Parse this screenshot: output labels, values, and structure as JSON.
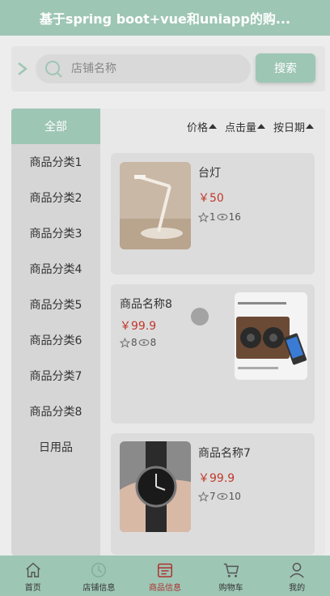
{
  "header": {
    "title": "基于spring boot+vue和uniapp的购..."
  },
  "search": {
    "placeholder": "店铺名称",
    "value": "",
    "button_label": "搜索"
  },
  "categories": [
    {
      "label": "全部",
      "active": true
    },
    {
      "label": "商品分类1"
    },
    {
      "label": "商品分类2"
    },
    {
      "label": "商品分类3"
    },
    {
      "label": "商品分类4"
    },
    {
      "label": "商品分类5"
    },
    {
      "label": "商品分类6"
    },
    {
      "label": "商品分类7"
    },
    {
      "label": "商品分类8"
    },
    {
      "label": "日用品"
    }
  ],
  "sort": {
    "price_label": "价格",
    "clicks_label": "点击量",
    "date_label": "按日期"
  },
  "products": [
    {
      "name": "台灯",
      "price": "￥50",
      "stars": "1",
      "views": "16",
      "image_icon": "desk-lamp-image"
    },
    {
      "name": "商品名称8",
      "price": "￥99.9",
      "stars": "8",
      "views": "8",
      "image_icon": "speaker-image"
    },
    {
      "name": "商品名称7",
      "price": "￥99.9",
      "stars": "7",
      "views": "10",
      "image_icon": "watch-image"
    }
  ],
  "tabbar": [
    {
      "label": "首页",
      "icon": "home-icon"
    },
    {
      "label": "店铺信息",
      "icon": "shop-icon"
    },
    {
      "label": "商品信息",
      "icon": "goods-icon",
      "active": true
    },
    {
      "label": "购物车",
      "icon": "cart-icon"
    },
    {
      "label": "我的",
      "icon": "user-icon"
    }
  ],
  "colors": {
    "accent": "#9ec6b5",
    "price": "#c0392b",
    "active_tab": "#b03030"
  }
}
